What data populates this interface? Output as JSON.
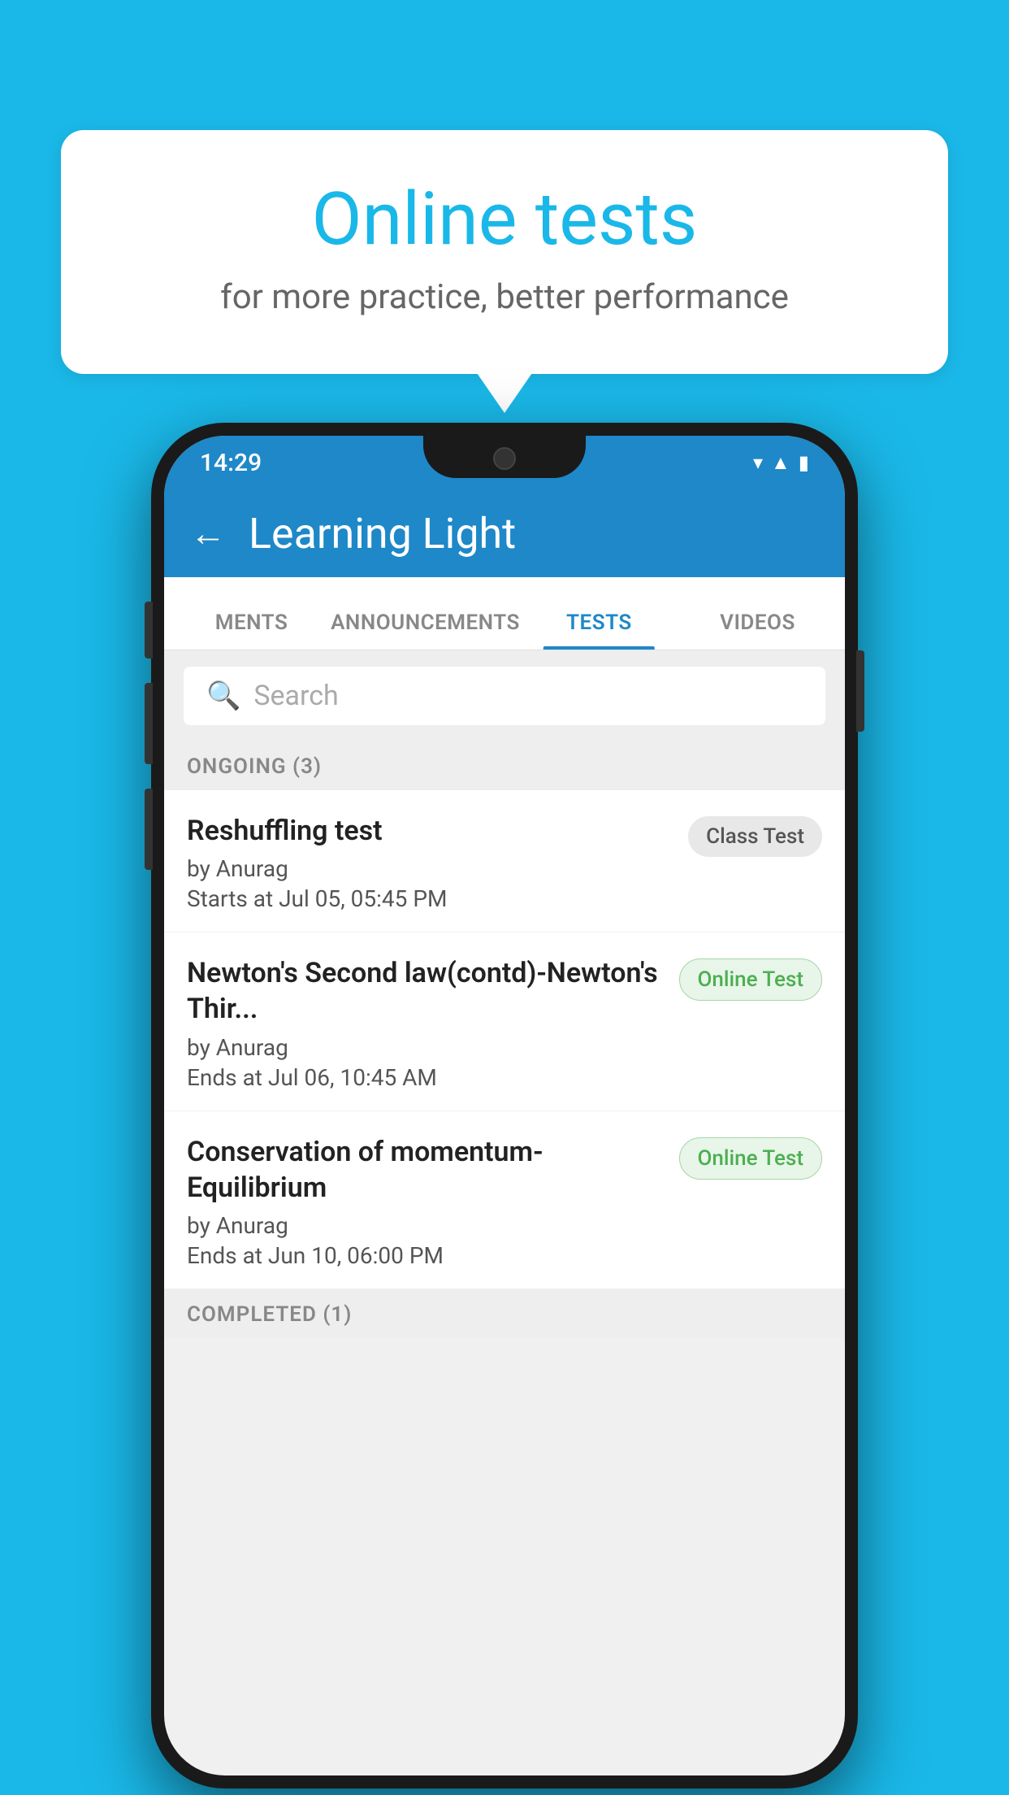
{
  "background_color": "#1ab8e8",
  "bubble": {
    "title": "Online tests",
    "subtitle": "for more practice, better performance"
  },
  "phone": {
    "status_bar": {
      "time": "14:29",
      "icons": [
        "wifi",
        "signal",
        "battery"
      ]
    },
    "app_bar": {
      "title": "Learning Light",
      "back_label": "←"
    },
    "tabs": [
      {
        "label": "MENTS",
        "active": false
      },
      {
        "label": "ANNOUNCEMENTS",
        "active": false
      },
      {
        "label": "TESTS",
        "active": true
      },
      {
        "label": "VIDEOS",
        "active": false
      }
    ],
    "search": {
      "placeholder": "Search"
    },
    "ongoing_section": {
      "label": "ONGOING (3)"
    },
    "tests": [
      {
        "name": "Reshuffling test",
        "author": "by Anurag",
        "time_label": "Starts at",
        "time": "Jul 05, 05:45 PM",
        "badge": "Class Test",
        "badge_type": "class"
      },
      {
        "name": "Newton's Second law(contd)-Newton's Thir...",
        "author": "by Anurag",
        "time_label": "Ends at",
        "time": "Jul 06, 10:45 AM",
        "badge": "Online Test",
        "badge_type": "online"
      },
      {
        "name": "Conservation of momentum-Equilibrium",
        "author": "by Anurag",
        "time_label": "Ends at",
        "time": "Jun 10, 06:00 PM",
        "badge": "Online Test",
        "badge_type": "online"
      }
    ],
    "completed_section": {
      "label": "COMPLETED (1)"
    }
  }
}
